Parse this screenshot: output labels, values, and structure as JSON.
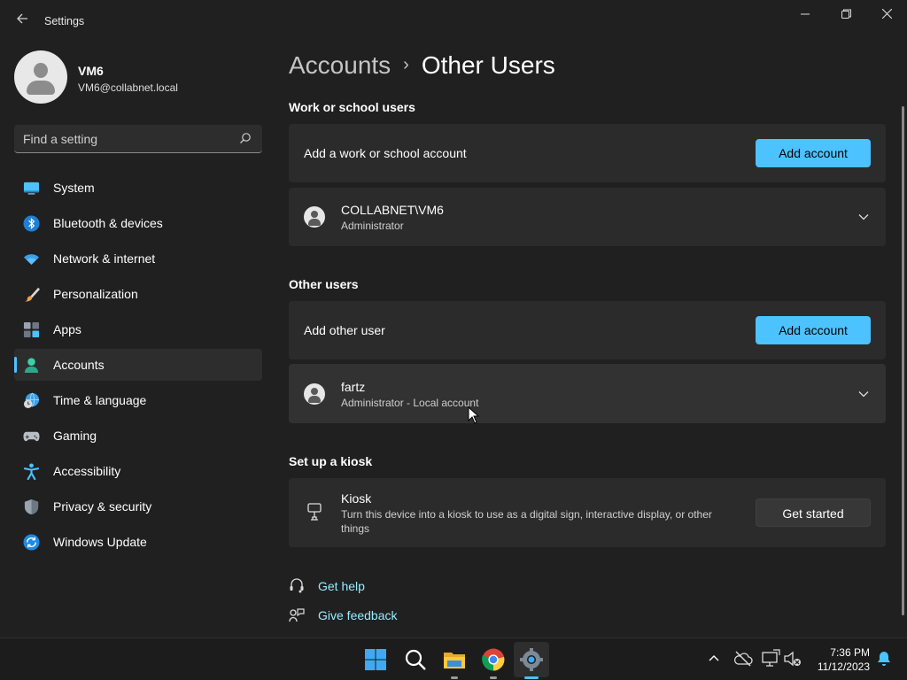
{
  "window": {
    "title": "Settings"
  },
  "profile": {
    "name": "VM6",
    "email": "VM6@collabnet.local"
  },
  "search": {
    "placeholder": "Find a setting"
  },
  "nav": {
    "items": [
      {
        "label": "System",
        "icon": "system-icon"
      },
      {
        "label": "Bluetooth & devices",
        "icon": "bluetooth-icon"
      },
      {
        "label": "Network & internet",
        "icon": "network-icon"
      },
      {
        "label": "Personalization",
        "icon": "brush-icon"
      },
      {
        "label": "Apps",
        "icon": "apps-icon"
      },
      {
        "label": "Accounts",
        "icon": "accounts-icon",
        "selected": true
      },
      {
        "label": "Time & language",
        "icon": "time-language-icon"
      },
      {
        "label": "Gaming",
        "icon": "gaming-icon"
      },
      {
        "label": "Accessibility",
        "icon": "accessibility-icon"
      },
      {
        "label": "Privacy & security",
        "icon": "shield-icon"
      },
      {
        "label": "Windows Update",
        "icon": "windows-update-icon"
      }
    ]
  },
  "breadcrumb": {
    "parent": "Accounts",
    "separator": "›",
    "current": "Other Users"
  },
  "work_school": {
    "title": "Work or school users",
    "add_text": "Add a work or school account",
    "add_button": "Add account",
    "user": {
      "name": "COLLABNET\\VM6",
      "role": "Administrator"
    }
  },
  "other_users": {
    "title": "Other users",
    "add_text": "Add other user",
    "add_button": "Add account",
    "user": {
      "name": "fartz",
      "role": "Administrator - Local account"
    }
  },
  "kiosk": {
    "section_title": "Set up a kiosk",
    "title": "Kiosk",
    "description_line1": "Turn this device into a kiosk to use as a digital sign, interactive display, or other",
    "description_line2": "things",
    "button": "Get started"
  },
  "links": {
    "help": "Get help",
    "feedback": "Give feedback"
  },
  "taskbar": {
    "time": "7:36 PM",
    "date": "11/12/2023"
  },
  "colors": {
    "accent": "#4cc2ff",
    "link": "#99ebff",
    "background": "#202020",
    "card": "#2b2b2b"
  }
}
